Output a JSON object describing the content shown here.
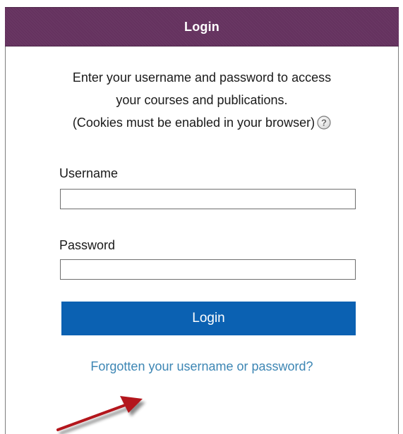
{
  "login_panel": {
    "header_title": "Login",
    "intro_line1": "Enter your username and password to access",
    "intro_line2": "your courses and publications.",
    "intro_line3": "(Cookies must be enabled in your browser)",
    "help_icon": "question-circle-icon",
    "username_label": "Username",
    "username_value": "",
    "password_label": "Password",
    "password_value": "",
    "login_button_label": "Login",
    "forgot_link_text": "Forgotten your username or password?",
    "annotation": "red-arrow-pointing-to-link"
  },
  "colors": {
    "header_bg": "#65325f",
    "button_bg": "#0b61b2",
    "link": "#3d86b4",
    "arrow": "#b3161d"
  }
}
